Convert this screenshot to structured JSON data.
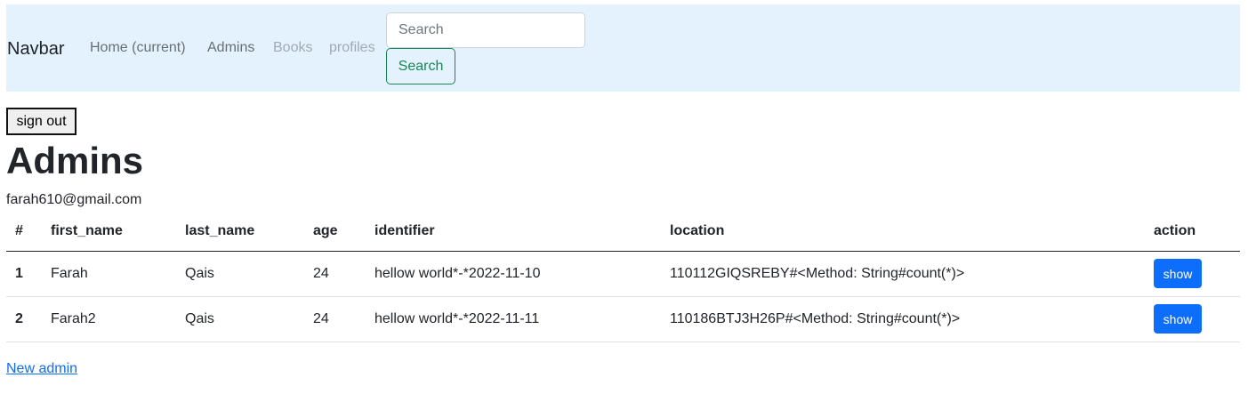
{
  "navbar": {
    "brand": "Navbar",
    "links": [
      {
        "label": "Home (current)"
      },
      {
        "label": "Admins"
      },
      {
        "label": "Books"
      },
      {
        "label": "profiles"
      }
    ],
    "search": {
      "placeholder": "Search",
      "value": "",
      "button_label": "Search"
    }
  },
  "signout_label": "sign out",
  "page": {
    "title": "Admins",
    "user_email": "farah610@gmail.com"
  },
  "table": {
    "headers": [
      "#",
      "first_name",
      "last_name",
      "age",
      "identifier",
      "location",
      "action"
    ],
    "rows": [
      {
        "num": "1",
        "first_name": "Farah",
        "last_name": "Qais",
        "age": "24",
        "identifier": "hellow world*-*2022-11-10",
        "location": "110112GIQSREBY#<Method: String#count(*)>",
        "action_label": "show"
      },
      {
        "num": "2",
        "first_name": "Farah2",
        "last_name": "Qais",
        "age": "24",
        "identifier": "hellow world*-*2022-11-11",
        "location": "110186BTJ3H26P#<Method: String#count(*)>",
        "action_label": "show"
      }
    ]
  },
  "new_admin_label": "New admin",
  "colors": {
    "navbar_bg": "#e3f2fd",
    "primary": "#0d6efd",
    "success": "#198754"
  }
}
